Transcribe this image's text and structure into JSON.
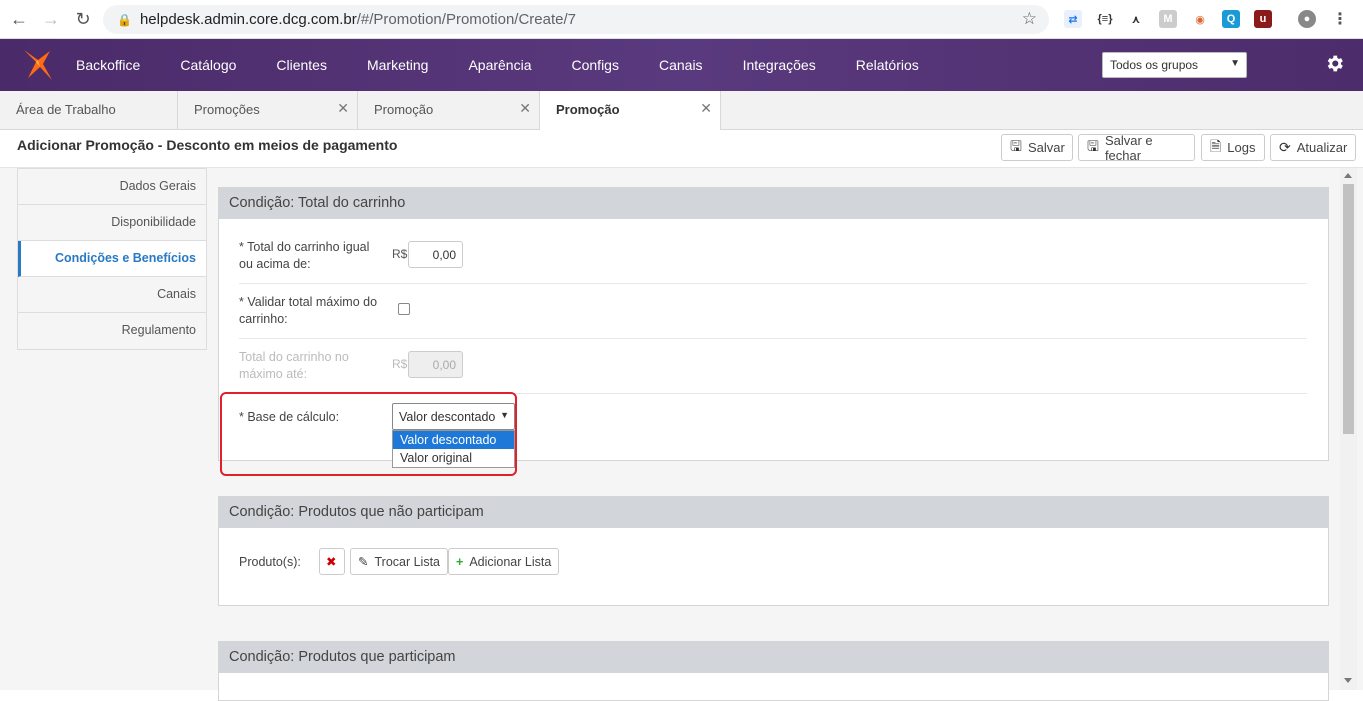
{
  "browser": {
    "url_host": "helpdesk.admin.core.dcg.com.br",
    "url_path": "/#/Promotion/Promotion/Create/7"
  },
  "topnav": {
    "items": [
      "Backoffice",
      "Catálogo",
      "Clientes",
      "Marketing",
      "Aparência",
      "Configs",
      "Canais",
      "Integrações",
      "Relatórios"
    ],
    "group_select": "Todos os grupos"
  },
  "tabs": [
    {
      "label": "Área de Trabalho"
    },
    {
      "label": "Promoções"
    },
    {
      "label": "Promoção"
    },
    {
      "label": "Promoção"
    }
  ],
  "page": {
    "title": "Adicionar Promoção - Desconto em meios de pagamento",
    "buttons": {
      "save": "Salvar",
      "save_close": "Salvar e fechar",
      "logs": "Logs",
      "refresh": "Atualizar"
    }
  },
  "sidenav": {
    "items": [
      "Dados Gerais",
      "Disponibilidade",
      "Condições e Benefícios",
      "Canais",
      "Regulamento"
    ]
  },
  "panel_total": {
    "header": "Condição: Total do carrinho",
    "total_label_1": "* Total do carrinho igual",
    "total_label_2": "ou acima de:",
    "currency": "R$",
    "total_value": "0,00",
    "validate_label_1": "* Validar total máximo do",
    "validate_label_2": "carrinho:",
    "max_label_1": "Total do carrinho no",
    "max_label_2": "máximo até:",
    "max_value": "0,00",
    "base_label": "* Base de cálculo:",
    "base_selected": "Valor descontado",
    "base_options": [
      "Valor descontado",
      "Valor original"
    ]
  },
  "panel_excluded": {
    "header": "Condição: Produtos que não participam",
    "products_label": "Produto(s):",
    "swap_list": "Trocar Lista",
    "add_list": "Adicionar Lista"
  },
  "panel_included": {
    "header": "Condição: Produtos que participam"
  }
}
